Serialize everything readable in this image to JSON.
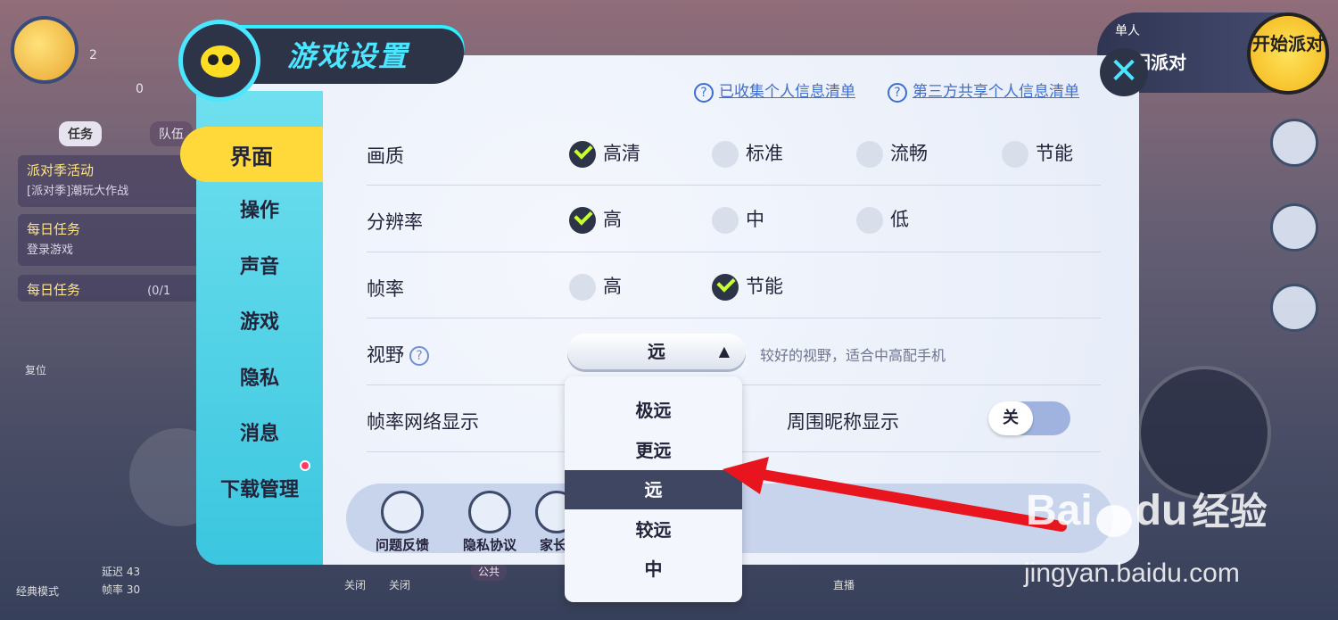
{
  "hud": {
    "level": "2",
    "coins": "0",
    "tab_tasks": "任务",
    "tab_team": "队伍",
    "event_title": "派对季活动",
    "event_sub": "[派对季]潮玩大作战",
    "daily_title": "每日任务",
    "daily_sub": "登录游戏",
    "daily2_title": "每日任务",
    "daily2_progress": "(0/1",
    "reset_label": "复位",
    "classic_mode": "经典模式",
    "latency": "延迟 43",
    "framerate": "帧率 30",
    "bottom_close1": "关闭",
    "bottom_close2": "关闭",
    "public": "公共",
    "live": "直播"
  },
  "start_party": {
    "mode_small": "单人",
    "mode": "休闲派对",
    "button": "开始派对"
  },
  "panel": {
    "title": "游戏设置",
    "close_symbol": "✕",
    "link1": "已收集个人信息清单",
    "link2": "第三方共享个人信息清单",
    "nav": [
      "界面",
      "操作",
      "声音",
      "游戏",
      "隐私",
      "消息",
      "下载管理"
    ],
    "rows": {
      "quality": {
        "label": "画质",
        "options": [
          "高清",
          "标准",
          "流畅",
          "节能"
        ],
        "selected": "高清"
      },
      "resolution": {
        "label": "分辨率",
        "options": [
          "高",
          "中",
          "低"
        ],
        "selected": "高"
      },
      "fps": {
        "label": "帧率",
        "options": [
          "高",
          "节能"
        ],
        "selected": "节能"
      },
      "view": {
        "label": "视野",
        "value": "远",
        "hint": "较好的视野，适合中高配手机"
      },
      "net": {
        "label": "帧率网络显示"
      },
      "nickname": {
        "label": "周围昵称显示",
        "toggle": "关"
      }
    },
    "bottom": [
      "问题反馈",
      "隐私协议",
      "家长"
    ],
    "menu": [
      "极远",
      "更远",
      "远",
      "较远",
      "中"
    ],
    "menu_selected": "远"
  },
  "watermark": {
    "logo": "Bai",
    "logo2": "du",
    "cn": "经验",
    "url": "jingyan.baidu.com"
  },
  "colors": {
    "accent": "#4be6ff",
    "sidebar": "#3bc6df",
    "active_nav": "#ffd93a",
    "arrow": "#e8141e"
  }
}
